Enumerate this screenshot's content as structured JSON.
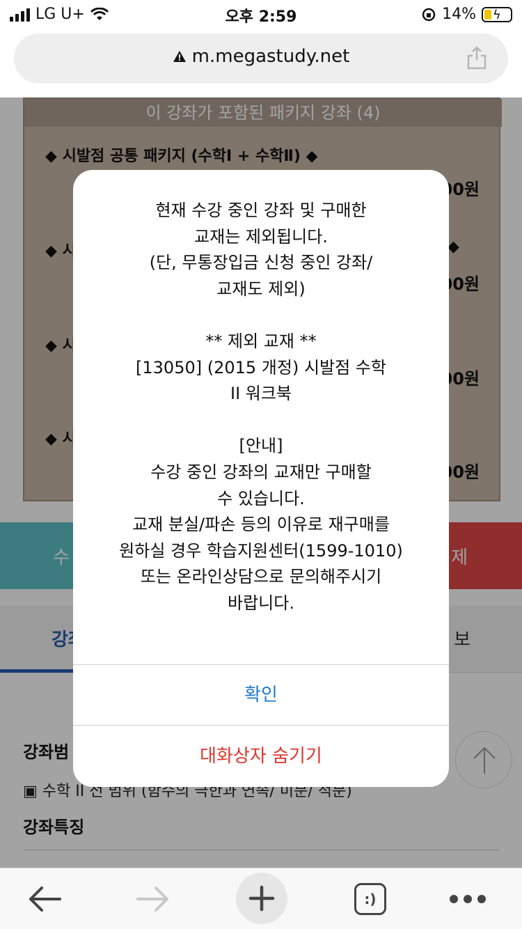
{
  "status_bar": {
    "carrier": "LG U+",
    "time": "오후 2:59",
    "battery": "14%",
    "battery_level": 0.14
  },
  "url_bar": {
    "url": "m.megastudy.net",
    "icons": [
      "warning-icon",
      "share-icon"
    ]
  },
  "background_page": {
    "package_box": {
      "title": "이 강좌가 포함된 패키지 강좌 (4)",
      "items": [
        {
          "name": "◆ 시발점 공통 패키지 (수학Ⅰ + 수학Ⅱ) ◆",
          "price": "00원"
        },
        {
          "name": "◆ 시",
          "suffix": "◆",
          "price": "00원"
        },
        {
          "name": "◆ 시",
          "price": "00원"
        },
        {
          "name": "◆ 시",
          "price": "00원"
        }
      ]
    },
    "buttons": {
      "left_label": "수",
      "right_label": "제"
    },
    "tabs": {
      "active_label": "강좌",
      "right_label": "보"
    },
    "info": {
      "section1_title": "강좌범",
      "section1_line": "▣ 수학 II 전 범위 (함수의 극한과 연속/ 미분/ 적분)",
      "section2_title": "강좌특징"
    }
  },
  "dialog": {
    "message_lines": [
      "현재 수강 중인 강좌 및 구매한",
      "교재는 제외됩니다.",
      "(단, 무통장입금 신청 중인 강좌/",
      "교재도 제외)",
      "",
      "** 제외 교재 **",
      "[13050] (2015 개정) 시발점 수학",
      "II 워크북",
      "",
      "[안내]",
      "수강 중인 강좌의 교재만 구매할",
      "수 있습니다.",
      "교재 분실/파손 등의 이유로 재구매를",
      "원하실 경우 학습지원센터(1599-1010)",
      "또는 온라인상담으로 문의해주시기",
      "바랍니다."
    ],
    "confirm_label": "확인",
    "hide_label": "대화상자 숨기기"
  },
  "toolbar": {
    "icons": [
      "back-arrow-icon",
      "forward-arrow-icon",
      "plus-icon",
      "smiley-tab-icon",
      "more-icon"
    ],
    "tab_icon_text": ":)"
  },
  "colors": {
    "link_blue": "#1f7ad1",
    "destructive_red": "#e0352b",
    "teal": "#5fc3c9",
    "red_button": "#e24848",
    "tab_blue": "#2a5fb0"
  }
}
